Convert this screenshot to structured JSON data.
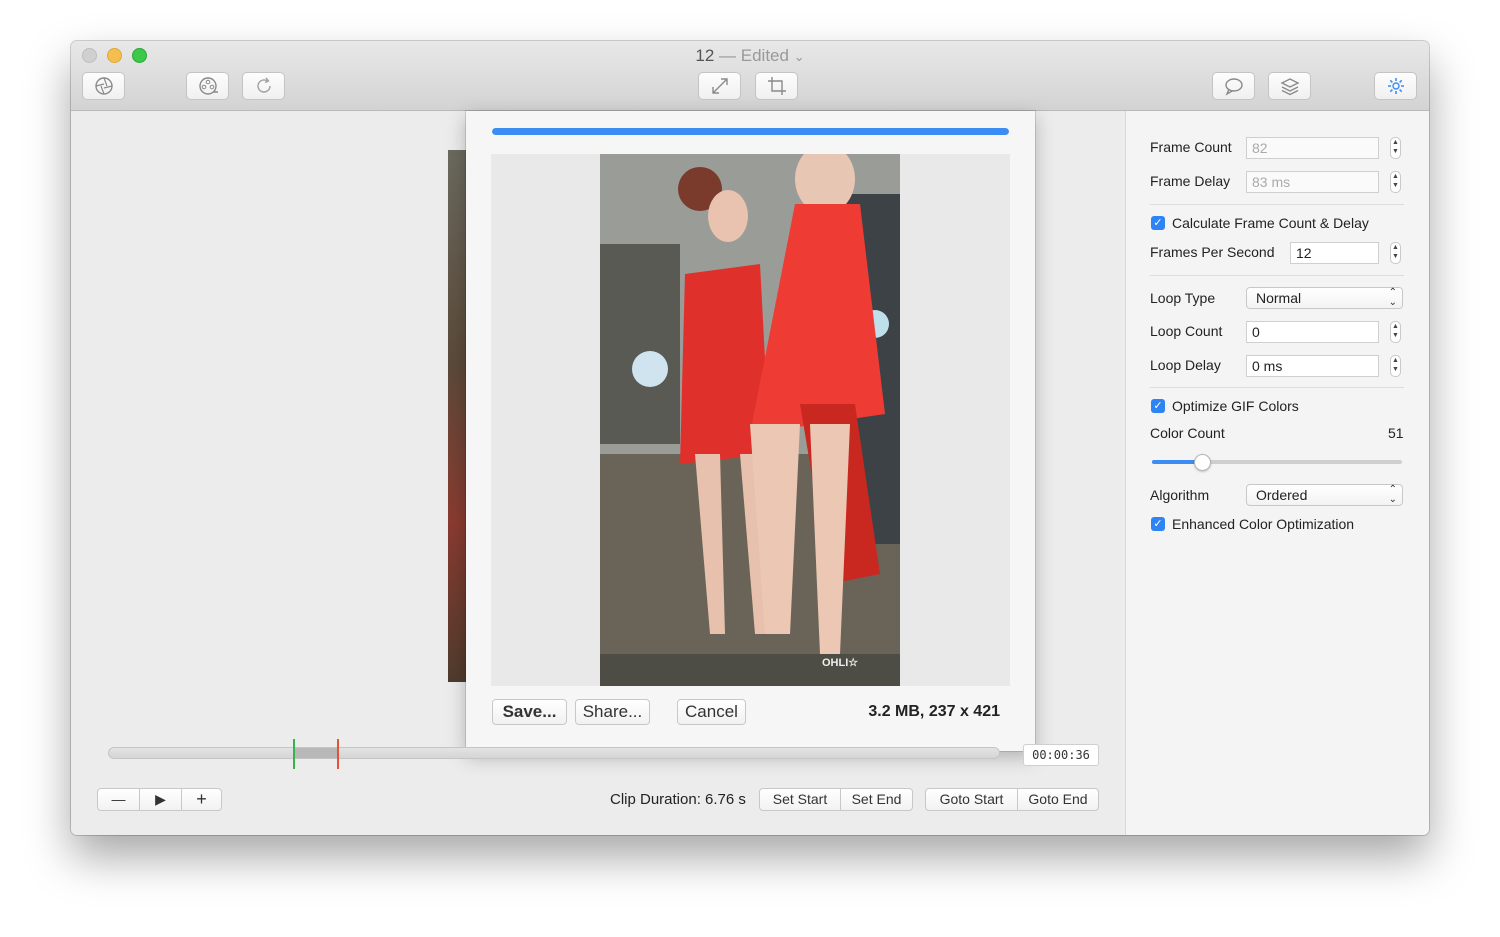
{
  "window": {
    "title": "12",
    "title_separator": " — ",
    "title_status": "Edited",
    "title_chevron": "⌄"
  },
  "toolbar": {
    "icons": [
      "aperture-icon",
      "film-reel-icon",
      "refresh-icon",
      "resize-icon",
      "crop-icon",
      "speech-bubble-icon",
      "layers-icon",
      "gear-icon"
    ]
  },
  "export_sheet": {
    "progress": 1.0,
    "save_label": "Save...",
    "share_label": "Share...",
    "cancel_label": "Cancel",
    "file_info": "3.2 MB, 237 x 421",
    "watermark": "OHLI☆"
  },
  "timeline": {
    "timecode": "00:00:36",
    "clip_duration": "Clip Duration: 6.76 s",
    "zoom_out_label": "—",
    "play_label": "▶",
    "zoom_in_label": "+",
    "set_start_label": "Set Start",
    "set_end_label": "Set End",
    "goto_start_label": "Goto Start",
    "goto_end_label": "Goto End"
  },
  "settings": {
    "frame_count_label": "Frame Count",
    "frame_count_value": "82",
    "frame_delay_label": "Frame Delay",
    "frame_delay_value": "83 ms",
    "calc_label": "Calculate Frame Count & Delay",
    "calc_checked": true,
    "fps_label": "Frames Per Second",
    "fps_value": "12",
    "loop_type_label": "Loop Type",
    "loop_type_value": "Normal",
    "loop_count_label": "Loop Count",
    "loop_count_value": "0",
    "loop_delay_label": "Loop Delay",
    "loop_delay_value": "0 ms",
    "optimize_label": "Optimize GIF Colors",
    "optimize_checked": true,
    "color_count_label": "Color Count",
    "color_count_value": "51",
    "color_count_fraction": 0.2,
    "algorithm_label": "Algorithm",
    "algorithm_value": "Ordered",
    "enhanced_label": "Enhanced Color Optimization",
    "enhanced_checked": true
  },
  "colors": {
    "accent": "#3b8cf3",
    "start_marker": "#38b24a",
    "end_marker": "#e4523b"
  }
}
